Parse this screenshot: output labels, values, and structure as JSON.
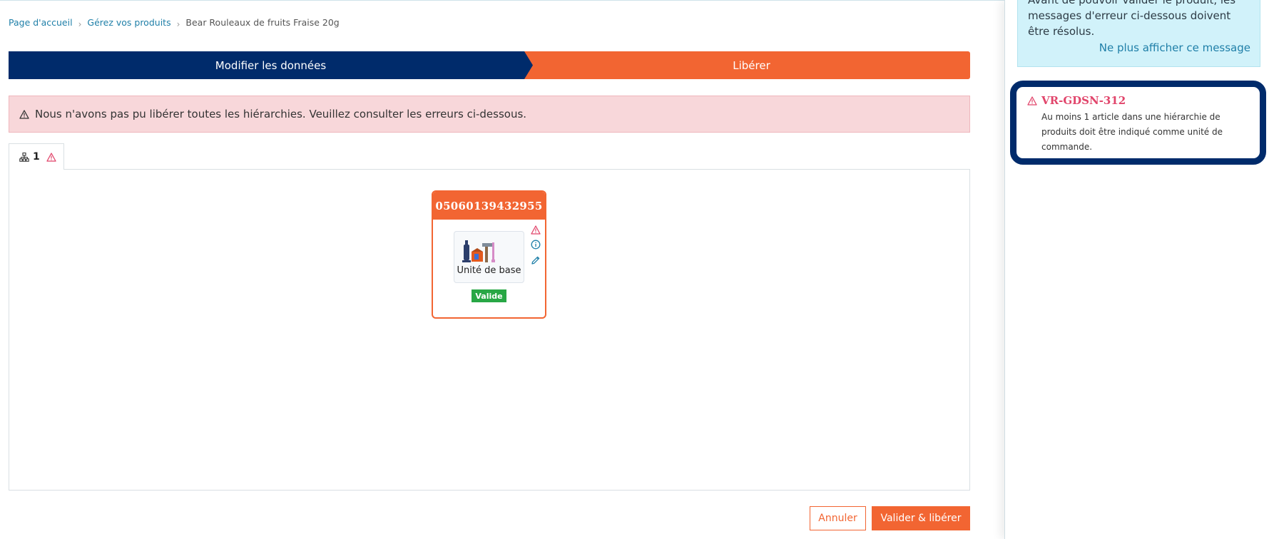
{
  "breadcrumb": {
    "home": "Page d'accueil",
    "products": "Gérez vos produits",
    "current": "Bear Rouleaux de fruits Fraise 20g"
  },
  "steps": {
    "step1": "Modifier les données",
    "step2": "Libérer"
  },
  "alert": {
    "message": "Nous n'avons pas pu libérer toutes les hiérarchies. Veuillez consulter les erreurs ci-dessous."
  },
  "tabs": [
    {
      "label": "1",
      "icon": "hierarchy-icon",
      "status_icon": "warning-icon"
    }
  ],
  "card": {
    "gtin": "05060139432955",
    "unit_label": "Unité de base",
    "status": "Valide",
    "icons": [
      "warning-icon",
      "info-icon",
      "edit-icon"
    ]
  },
  "buttons": {
    "cancel": "Annuler",
    "validate": "Valider & libérer"
  },
  "sidebar": {
    "info_text": "Avant de pouvoir valider le produit, les messages d'erreur ci-dessous doivent être résolus.",
    "dismiss_link": "Ne plus afficher ce message",
    "errors": [
      {
        "code": "VR-GDSN-312",
        "description": "Au moins 1 article dans une hiérarchie de produits doit être indiqué comme unité de commande."
      }
    ]
  },
  "colors": {
    "navy": "#002b6b",
    "orange": "#f26532",
    "alert_bg": "#f8d7da",
    "info_bg": "#d1f2fa",
    "valid_green": "#28a745",
    "error_pink": "#e1456b",
    "link_blue": "#1f7fa8"
  }
}
